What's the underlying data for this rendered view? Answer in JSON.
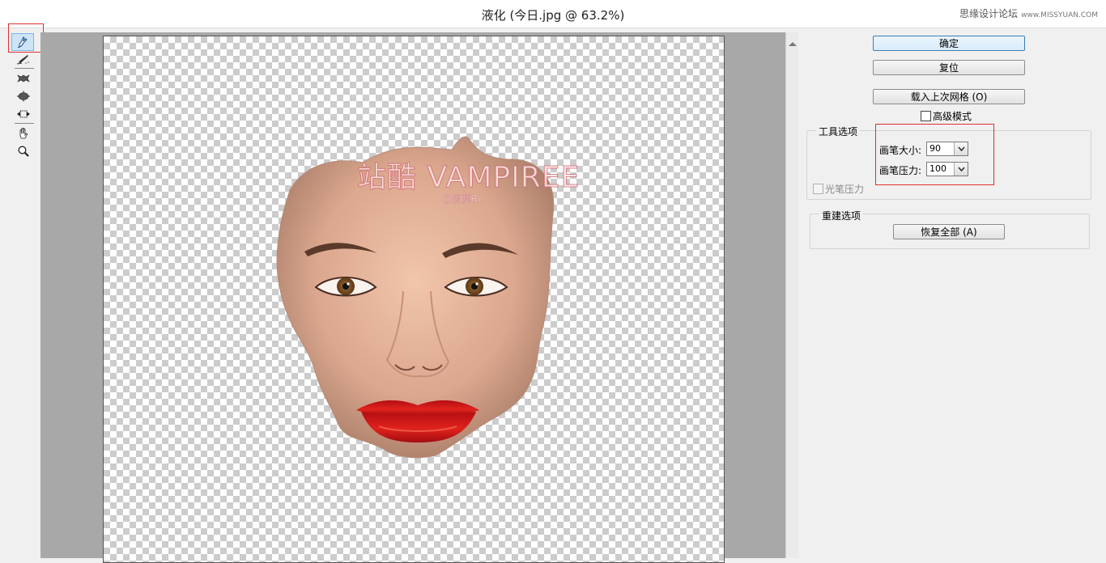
{
  "window": {
    "title": "液化 (今日.jpg @ 63.2%)",
    "watermark_text": "思缘设计论坛",
    "watermark_url": "www.MISSYUAN.COM"
  },
  "toolbar": {
    "tools": [
      {
        "name": "forward-warp-tool",
        "icon": "finger-brush-icon",
        "active": true
      },
      {
        "name": "reconstruct-tool",
        "icon": "brush-icon",
        "active": false
      },
      {
        "name": "pucker-tool",
        "icon": "pucker-icon",
        "active": false
      },
      {
        "name": "bloat-tool",
        "icon": "bloat-icon",
        "active": false
      },
      {
        "name": "push-left-tool",
        "icon": "push-left-icon",
        "active": false
      },
      {
        "name": "hand-tool",
        "icon": "hand-icon",
        "active": false
      },
      {
        "name": "zoom-tool",
        "icon": "zoom-icon",
        "active": false
      }
    ]
  },
  "canvas": {
    "image_watermark": "站酷 VAMPIREE",
    "image_credit": "@周腮Rc"
  },
  "panel": {
    "ok_label": "确定",
    "reset_label": "复位",
    "load_mesh_label": "载入上次网格 (O)",
    "advanced_mode_label": "高级模式",
    "advanced_mode_checked": false,
    "tool_options_title": "工具选项",
    "brush_size_label": "画笔大小:",
    "brush_size_value": "90",
    "brush_pressure_label": "画笔压力:",
    "brush_pressure_value": "100",
    "stylus_pressure_label": "光笔压力",
    "stylus_pressure_checked": false,
    "reconstruct_title": "重建选项",
    "restore_all_label": "恢复全部 (A)"
  },
  "colors": {
    "annotation": "#e03030",
    "accent": "#3c7fb1",
    "lips": "#d0141a"
  }
}
